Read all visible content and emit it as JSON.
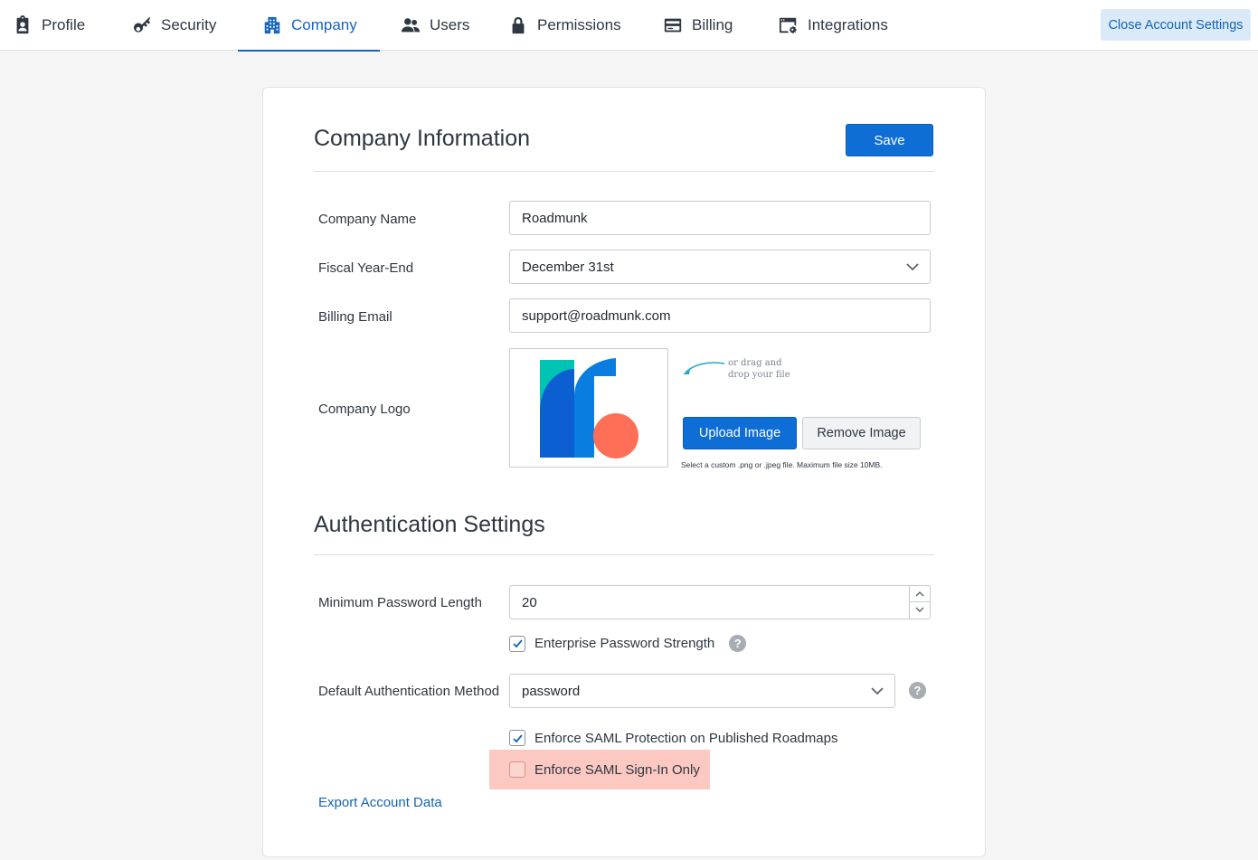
{
  "nav": {
    "tabs": [
      {
        "label": "Profile",
        "icon": "clipboard-badge-icon"
      },
      {
        "label": "Security",
        "icon": "key-icon"
      },
      {
        "label": "Company",
        "icon": "building-icon",
        "active": true
      },
      {
        "label": "Users",
        "icon": "users-icon"
      },
      {
        "label": "Permissions",
        "icon": "lock-icon"
      },
      {
        "label": "Billing",
        "icon": "credit-card-icon"
      },
      {
        "label": "Integrations",
        "icon": "browser-gear-icon"
      }
    ],
    "close_label": "Close Account Settings"
  },
  "company": {
    "title": "Company Information",
    "save_label": "Save",
    "name_label": "Company Name",
    "name_value": "Roadmunk",
    "fiscal_label": "Fiscal Year-End",
    "fiscal_value": "December 31st",
    "email_label": "Billing Email",
    "email_value": "support@roadmunk.com",
    "logo_label": "Company Logo",
    "drag_hint_line1": "or drag and",
    "drag_hint_line2": "drop your file",
    "upload_label": "Upload Image",
    "remove_label": "Remove Image",
    "file_note": "Select a custom .png or .jpeg file. Maximum file size 10MB."
  },
  "auth": {
    "title": "Authentication Settings",
    "min_pw_label": "Minimum Password Length",
    "min_pw_value": "20",
    "enterprise_pw_label": "Enterprise Password Strength",
    "enterprise_pw_checked": true,
    "default_method_label": "Default Authentication Method",
    "default_method_value": "password",
    "enforce_published_label": "Enforce SAML Protection on Published Roadmaps",
    "enforce_published_checked": true,
    "enforce_signin_label": "Enforce SAML Sign-In Only",
    "enforce_signin_checked": false,
    "export_label": "Export Account Data"
  },
  "colors": {
    "accent": "#1565c0",
    "primary_button": "#0f6ed6",
    "highlight": "#fbc9c1",
    "logo_teal": "#00c4b3",
    "logo_blue": "#0a7de0",
    "logo_dark_blue": "#0b5fd0",
    "logo_coral": "#ff6f57"
  }
}
